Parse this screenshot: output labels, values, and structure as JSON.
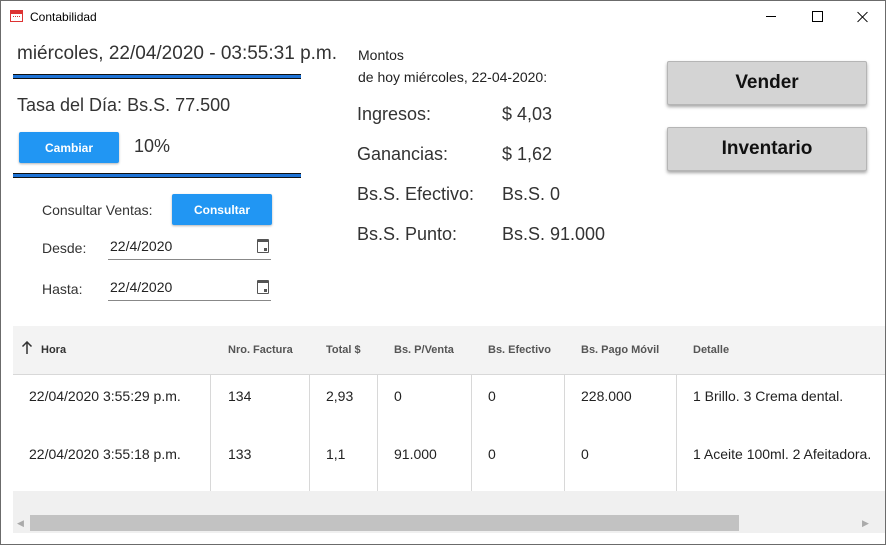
{
  "window": {
    "title": "Contabilidad",
    "icon": "calendar-app-icon",
    "controls": [
      "minimize-icon",
      "maximize-icon",
      "close-icon"
    ]
  },
  "left": {
    "datetime": "miércoles, 22/04/2020 - 03:55:31 p.m.",
    "tasa_label": "Tasa del Día:",
    "tasa_value": "Bs.S. 77.500",
    "cambiar_label": "Cambiar",
    "percent": "10%",
    "consultar_label": "Consultar Ventas:",
    "consultar_button": "Consultar",
    "desde_label": "Desde:",
    "desde_value": "22/4/2020",
    "hasta_label": "Hasta:",
    "hasta_value": "22/4/2020"
  },
  "montos": {
    "line1": "Montos",
    "line2": "de hoy miércoles, 22-04-2020:",
    "rows": [
      {
        "label": "Ingresos:",
        "value": "$ 4,03"
      },
      {
        "label": "Ganancias:",
        "value": "$ 1,62"
      },
      {
        "label": "Bs.S. Efectivo:",
        "value": "Bs.S. 0"
      },
      {
        "label": "Bs.S. Punto:",
        "value": "Bs.S. 91.000"
      }
    ]
  },
  "actions": {
    "vender": "Vender",
    "inventario": "Inventario"
  },
  "table": {
    "sort_icon": "arrow-up-icon",
    "columns": [
      "Hora",
      "Nro. Factura",
      "Total $",
      "Bs. P/Venta",
      "Bs. Efectivo",
      "Bs. Pago Móvil",
      "Detalle"
    ],
    "rows": [
      [
        "22/04/2020 3:55:29 p.m.",
        "134",
        "2,93",
        "0",
        "0",
        "228.000",
        "1 Brillo. 3 Crema dental."
      ],
      [
        "22/04/2020 3:55:18 p.m.",
        "133",
        "1,1",
        "91.000",
        "0",
        "0",
        "1 Aceite 100ml. 2 Afeitadora."
      ]
    ]
  },
  "colors": {
    "accent_blue": "#2196F3",
    "separator_blue": "#1E73D6",
    "gray_button": "#D4D4D4"
  }
}
